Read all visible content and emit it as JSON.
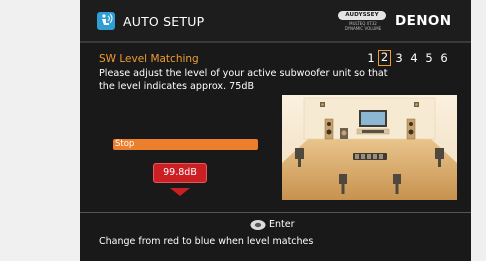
{
  "header": {
    "title": "AUTO SETUP",
    "audyssey": {
      "badge": "AUDYSSEY",
      "line1": "MULTEQ XT32",
      "line2": "DYNAMIC VOLUME"
    },
    "brand": "DENON"
  },
  "section": {
    "title": "SW Level Matching",
    "steps": [
      "1",
      "2",
      "3",
      "4",
      "5",
      "6"
    ],
    "active_step": "2"
  },
  "instructions": "Please adjust the level of your active subwoofer unit so that the level indicates approx. 75dB",
  "level": {
    "bar_label": "Stop",
    "value": "99.8dB",
    "badge_color": "#cc1f24",
    "bar_color": "#ec7f2c"
  },
  "footer": {
    "enter_label": "Enter",
    "hint": "Change from red to blue when level matches"
  },
  "icons": {
    "app": "auto-setup-icon",
    "enter": "enter-button-icon"
  },
  "colors": {
    "accent": "#f19b33",
    "background": "#191919"
  }
}
